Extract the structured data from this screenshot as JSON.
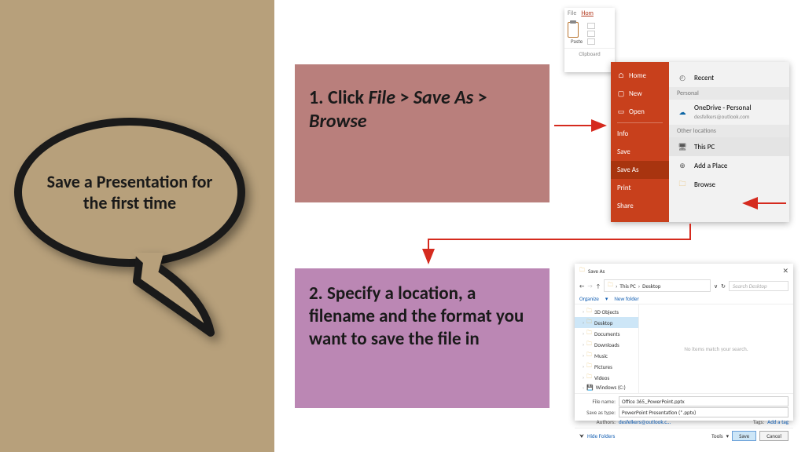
{
  "speech_bubble": {
    "text": "Save a Presentation for the first time"
  },
  "step1": {
    "prefix": "1. Click ",
    "a": "File",
    "sep1": " > ",
    "b": "Save As",
    "sep2": " > ",
    "c": "Browse"
  },
  "step2": {
    "text": "2. Specify a location, a filename and the format you want to save the file in"
  },
  "ribbon": {
    "tab_file": "File",
    "tab_home": "Hom",
    "paste": "Paste",
    "group": "Clipboard"
  },
  "backstage": {
    "left": {
      "home": "Home",
      "new": "New",
      "open": "Open",
      "info": "Info",
      "save": "Save",
      "save_as": "Save As",
      "print": "Print",
      "share": "Share"
    },
    "right": {
      "recent": "Recent",
      "personal_hdr": "Personal",
      "onedrive": "OneDrive - Personal",
      "onedrive_sub": "desfelkers@outlook.com",
      "other_hdr": "Other locations",
      "this_pc": "This PC",
      "add_place": "Add a Place",
      "browse": "Browse"
    }
  },
  "dialog": {
    "title": "Save As",
    "crumb1": "This PC",
    "crumb2": "Desktop",
    "search_ph": "Search Desktop",
    "organize": "Organize",
    "new_folder": "New folder",
    "tree": [
      "3D Objects",
      "Desktop",
      "Documents",
      "Downloads",
      "Music",
      "Pictures",
      "Videos",
      "Windows (C:)"
    ],
    "no_items": "No items match your search.",
    "file_name_lab": "File name:",
    "file_name": "Office 365_PowerPoint.pptx",
    "save_type_lab": "Save as type:",
    "save_type": "PowerPoint Presentation (*.pptx)",
    "authors_lab": "Authors:",
    "authors": "desfelkers@outlook.c…",
    "tags_lab": "Tags:",
    "tags": "Add a tag",
    "hide": "Hide Folders",
    "tools": "Tools",
    "save_btn": "Save",
    "cancel_btn": "Cancel"
  }
}
